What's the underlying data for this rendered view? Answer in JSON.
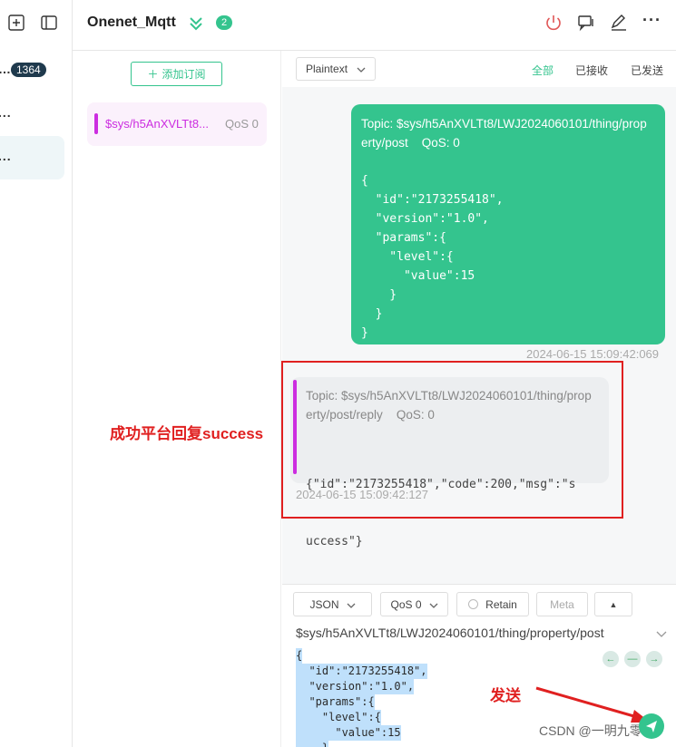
{
  "sidebar": {
    "badge_count": "1364",
    "dots_1": "...",
    "dots_2": "..."
  },
  "header": {
    "title": "Onenet_Mqtt",
    "connection_count": "2"
  },
  "subscriptions": {
    "add_label": "添加订阅",
    "items": [
      {
        "topic": "$sys/h5AnXVLTt8...",
        "qos": "QoS 0",
        "color": "#cc2de0"
      }
    ]
  },
  "messages": {
    "format_select": "Plaintext",
    "tabs": [
      "全部",
      "已接收",
      "已发送"
    ],
    "sent": {
      "topic_line1": "Topic: $sys/h5AnXVLTt8/LWJ2024060101/thing/prop",
      "topic_line2": "erty/post",
      "qos": "QoS: 0",
      "payload": "{\n  \"id\":\"2173255418\",\n  \"version\":\"1.0\",\n  \"params\":{\n    \"level\":{\n      \"value\":15\n    }\n  }\n}",
      "time": "2024-06-15 15:09:42:069"
    },
    "received": {
      "topic_line1": "Topic: $sys/h5AnXVLTt8/LWJ2024060101/thing/prop",
      "topic_line2": "erty/post/reply",
      "qos": "QoS: 0",
      "payload_line1": "{\"id\":\"2173255418\",\"code\":200,\"msg\":\"s",
      "payload_line2": "uccess\"}",
      "time": "2024-06-15 15:09:42:127"
    }
  },
  "annotations": {
    "reply_note": "成功平台回复success",
    "send_note": "发送"
  },
  "composer": {
    "payload_type": "JSON",
    "qos": "QoS 0",
    "retain_label": "Retain",
    "meta_label": "Meta",
    "topic": "$sys/h5AnXVLTt8/LWJ2024060101/thing/property/post",
    "payload_lines": [
      "{",
      "  \"id\":\"2173255418\",",
      "  \"version\":\"1.0\",",
      "  \"params\":{",
      "    \"level\":{",
      "      \"value\":15",
      "    }"
    ]
  },
  "watermark": "CSDN @一明九零",
  "colors": {
    "accent": "#34c48e",
    "subscription": "#cc2de0",
    "annotation": "#e02020"
  }
}
